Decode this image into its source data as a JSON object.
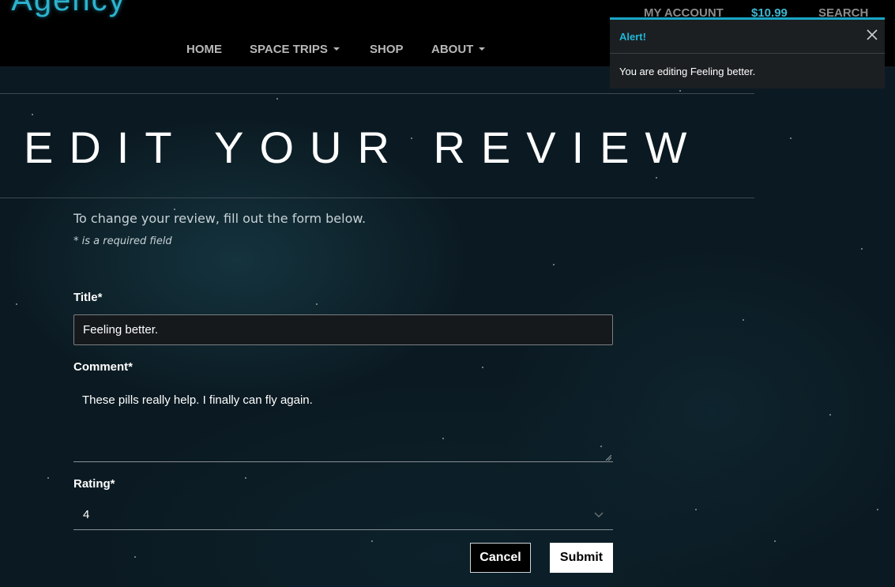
{
  "header": {
    "brand": "r Agency",
    "my_account": "MY ACCOUNT",
    "cart_total": "$10.99",
    "search": "SEARCH",
    "nav": [
      {
        "label": "HOME",
        "dropdown": false
      },
      {
        "label": "SPACE TRIPS",
        "dropdown": true
      },
      {
        "label": "SHOP",
        "dropdown": false
      },
      {
        "label": "ABOUT",
        "dropdown": true
      }
    ]
  },
  "alert": {
    "title": "Alert!",
    "message": "You are editing Feeling better.",
    "close_icon": "close-icon"
  },
  "page": {
    "title": "EDIT YOUR REVIEW",
    "intro": "To change your review, fill out the form below.",
    "required_note": "* is a required field"
  },
  "form": {
    "title_label": "Title*",
    "title_value": "Feeling better.",
    "comment_label": "Comment*",
    "comment_value": "These pills really help. I finally can fly again.",
    "rating_label": "Rating*",
    "rating_value": "4",
    "cancel_label": "Cancel",
    "submit_label": "Submit"
  },
  "colors": {
    "accent": "#1fb7d6",
    "header_bg": "#000000",
    "page_bg": "#0b1a22"
  }
}
